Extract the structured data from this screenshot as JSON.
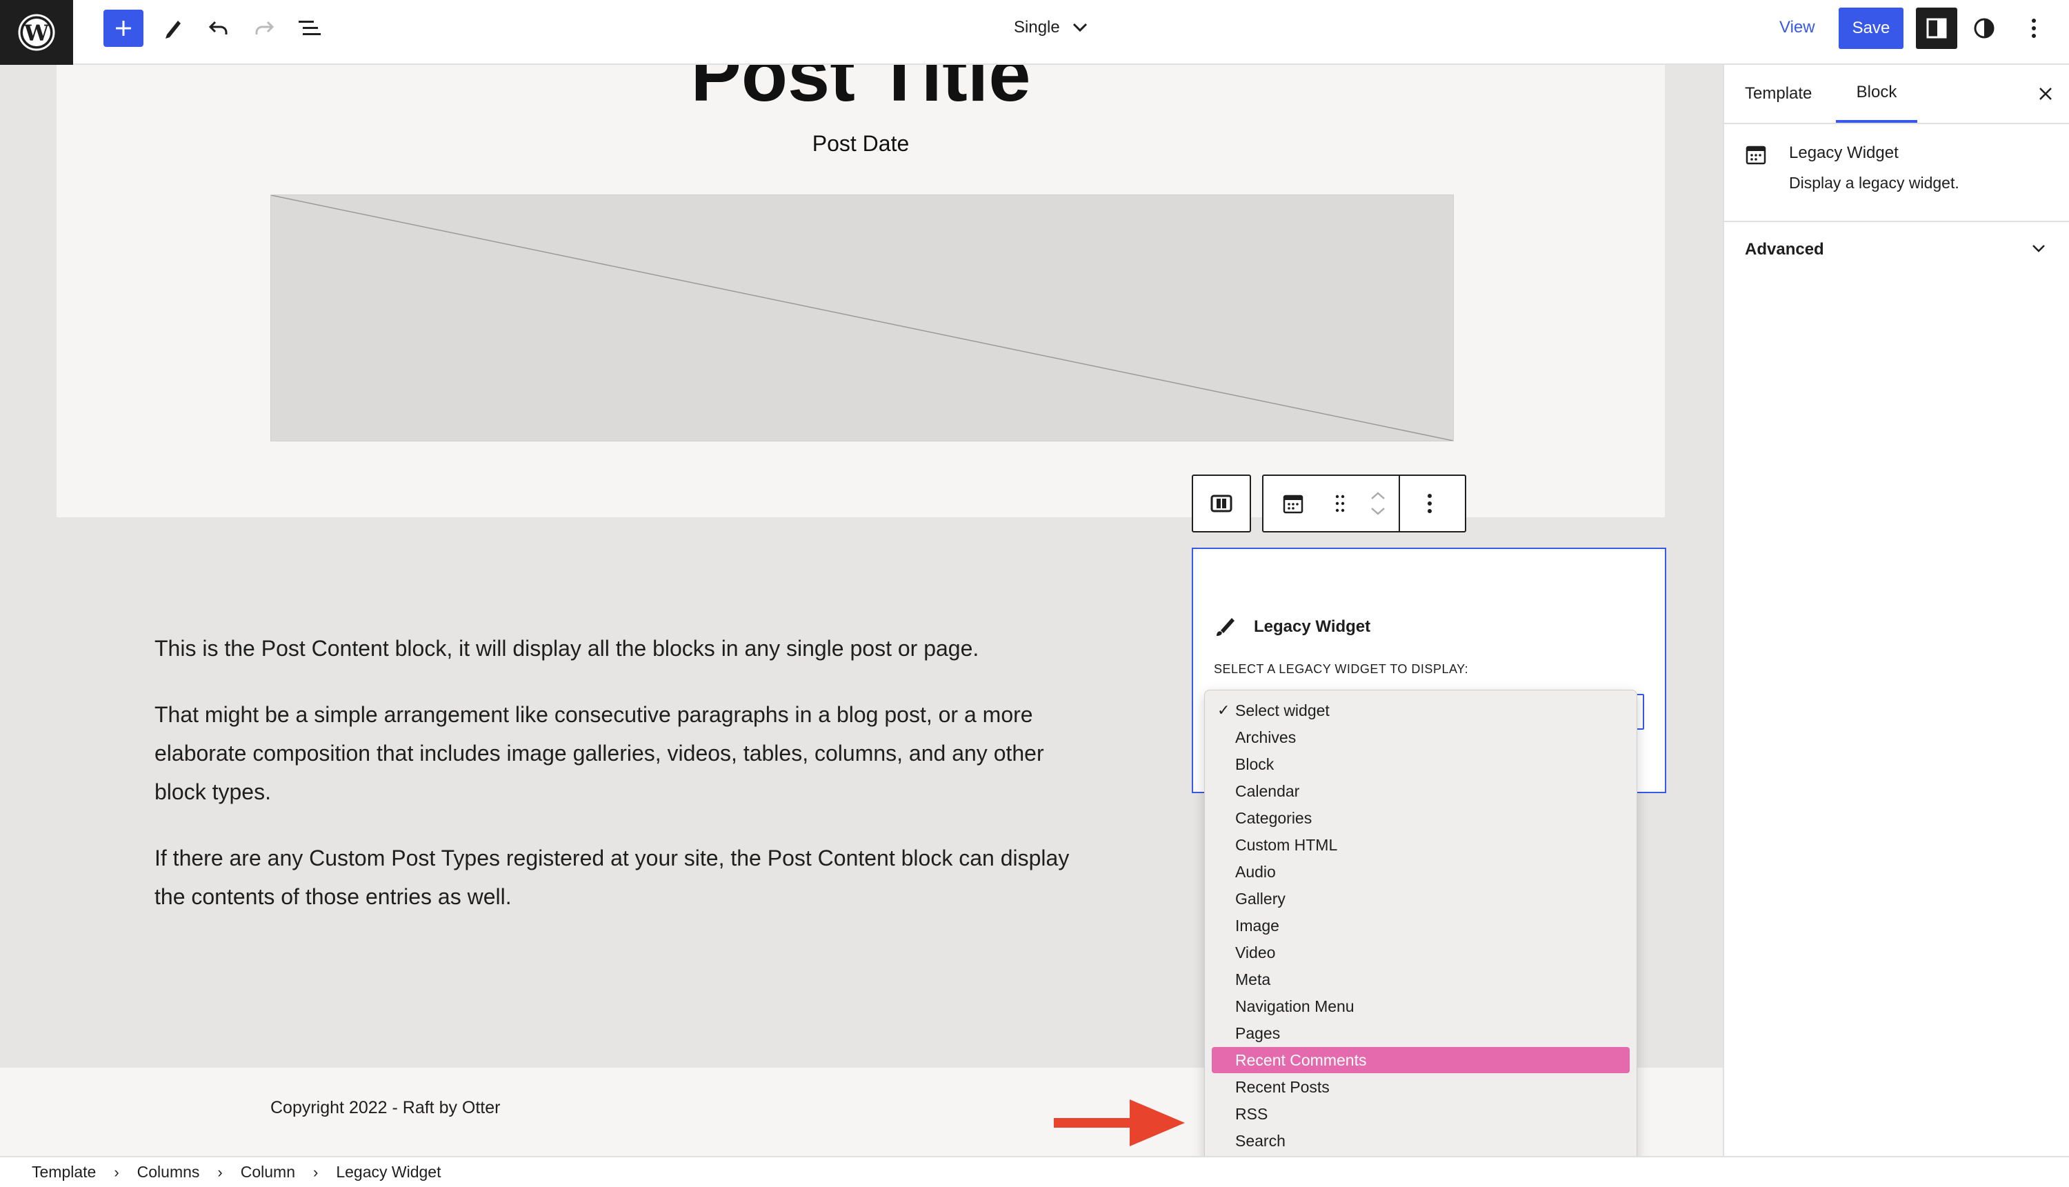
{
  "topbar": {
    "document_title": "Single",
    "view_label": "View",
    "save_label": "Save"
  },
  "canvas": {
    "post_title": "Post Title",
    "post_date": "Post Date",
    "post_content": [
      "This is the Post Content block, it will display all the blocks in any single post or page.",
      "That might be a simple arrangement like consecutive paragraphs in a blog post, or a more elaborate composition that includes image galleries, videos, tables, columns, and any other block types.",
      "If there are any Custom Post Types registered at your site, the Post Content block can display the contents of those entries as well."
    ],
    "copyright": "Copyright 2022 - Raft by Otter"
  },
  "widget": {
    "heading": "Legacy Widget",
    "select_label": "SELECT A LEGACY WIDGET TO DISPLAY:",
    "options": [
      "Select widget",
      "Archives",
      "Block",
      "Calendar",
      "Categories",
      "Custom HTML",
      "Audio",
      "Gallery",
      "Image",
      "Video",
      "Meta",
      "Navigation Menu",
      "Pages",
      "Recent Comments",
      "Recent Posts",
      "RSS",
      "Search"
    ],
    "checked_option": "Select widget",
    "highlighted_option": "Recent Comments",
    "highlight_color": "#e56aad"
  },
  "sidebar": {
    "tabs": [
      {
        "label": "Template",
        "active": false
      },
      {
        "label": "Block",
        "active": true
      }
    ],
    "block_card": {
      "title": "Legacy Widget",
      "description": "Display a legacy widget."
    },
    "advanced_label": "Advanced"
  },
  "breadcrumb": [
    "Template",
    "Columns",
    "Column",
    "Legacy Widget"
  ],
  "colors": {
    "accent": "#3858e9",
    "arrow": "#e8432d",
    "dark": "#1e1e1e"
  }
}
